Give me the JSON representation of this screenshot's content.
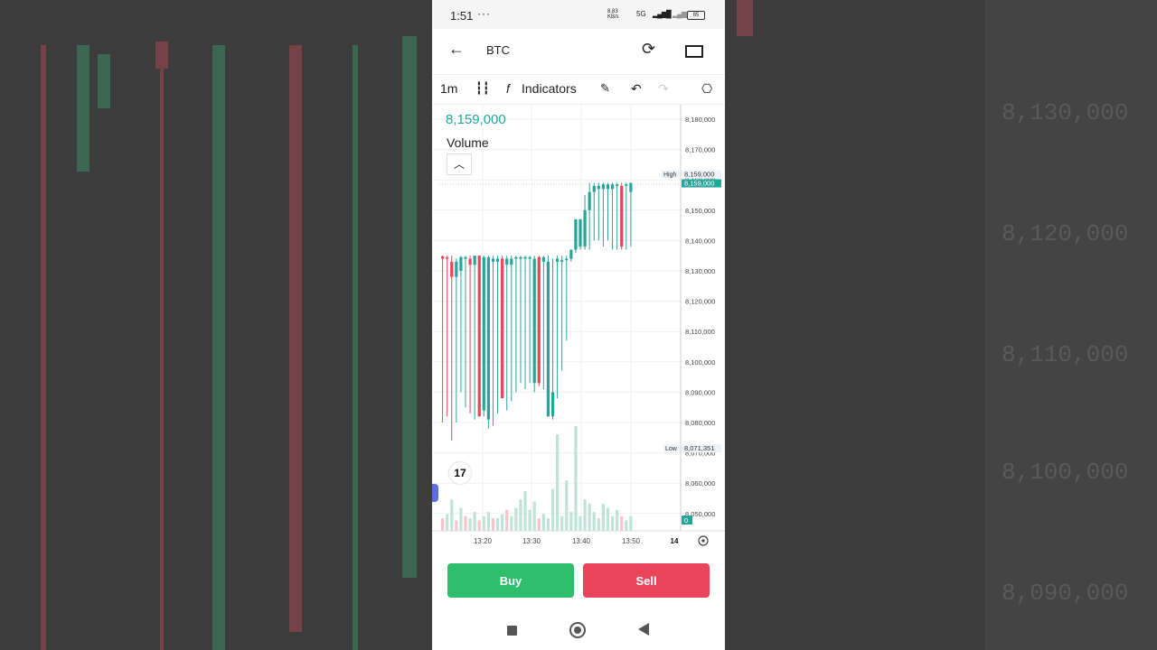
{
  "status_bar": {
    "time": "1:51",
    "notifications": "···",
    "speed_value": "8.83",
    "speed_unit": "KB/s",
    "network": "5G",
    "battery": "85"
  },
  "header": {
    "title": "BTC"
  },
  "toolbar": {
    "interval": "1m",
    "indicators_label": "Indicators"
  },
  "legend": {
    "price": "8,159,000",
    "volume_label": "Volume"
  },
  "actions": {
    "buy_label": "Buy",
    "sell_label": "Sell"
  },
  "colors": {
    "up": "#26a69a",
    "down": "#e9445a",
    "buy": "#2ebd6b",
    "sell": "#e9445a"
  },
  "chart_data": {
    "type": "candlestick",
    "price_axis": {
      "ticks": [
        8180000,
        8170000,
        8160000,
        8150000,
        8140000,
        8130000,
        8120000,
        8110000,
        8100000,
        8090000,
        8080000,
        8070000,
        8060000,
        8050000
      ],
      "tick_labels": [
        "8,180,000",
        "8,170,000",
        "8,160,000",
        "8,150,000",
        "8,140,000",
        "8,130,000",
        "8,120,000",
        "8,110,000",
        "8,100,000",
        "8,090,000",
        "8,080,000",
        "8,070,000",
        "8,060,000",
        "8,050,000"
      ]
    },
    "high_marker": {
      "label": "High",
      "value": "8,159,000"
    },
    "last_marker": {
      "value": "8,159,000"
    },
    "low_marker": {
      "label": "Low",
      "value": "8,071,351"
    },
    "volume_marker": "0",
    "time_axis": {
      "labels": [
        "13:20",
        "13:30",
        "13:40",
        "13:50",
        "14"
      ]
    },
    "candles": [
      {
        "o": 8134800,
        "h": 8135000,
        "l": 8080000,
        "c": 8134000,
        "d": "down"
      },
      {
        "o": 8134500,
        "h": 8135000,
        "l": 8082000,
        "c": 8134000,
        "d": "down"
      },
      {
        "o": 8133000,
        "h": 8135000,
        "l": 8074000,
        "c": 8128000,
        "d": "down"
      },
      {
        "o": 8128000,
        "h": 8134000,
        "l": 8080000,
        "c": 8133000,
        "d": "up"
      },
      {
        "o": 8130000,
        "h": 8135000,
        "l": 8090000,
        "c": 8134500,
        "d": "up"
      },
      {
        "o": 8134500,
        "h": 8135000,
        "l": 8085000,
        "c": 8134000,
        "d": "up"
      },
      {
        "o": 8134000,
        "h": 8135000,
        "l": 8083000,
        "c": 8132000,
        "d": "down"
      },
      {
        "o": 8132000,
        "h": 8135000,
        "l": 8081000,
        "c": 8135000,
        "d": "up"
      },
      {
        "o": 8135000,
        "h": 8135000,
        "l": 8082000,
        "c": 8082000,
        "d": "down"
      },
      {
        "o": 8084000,
        "h": 8135000,
        "l": 8082000,
        "c": 8134500,
        "d": "up"
      },
      {
        "o": 8134500,
        "h": 8135000,
        "l": 8078000,
        "c": 8081000,
        "d": "up"
      },
      {
        "o": 8134000,
        "h": 8135000,
        "l": 8079000,
        "c": 8133000,
        "d": "up"
      },
      {
        "o": 8133000,
        "h": 8135000,
        "l": 8083000,
        "c": 8134000,
        "d": "up"
      },
      {
        "o": 8134000,
        "h": 8135000,
        "l": 8088000,
        "c": 8088000,
        "d": "down"
      },
      {
        "o": 8134000,
        "h": 8135000,
        "l": 8084000,
        "c": 8132000,
        "d": "up"
      },
      {
        "o": 8132000,
        "h": 8135000,
        "l": 8087000,
        "c": 8134000,
        "d": "up"
      },
      {
        "o": 8134000,
        "h": 8135000,
        "l": 8090000,
        "c": 8134500,
        "d": "up"
      },
      {
        "o": 8134500,
        "h": 8135000,
        "l": 8093000,
        "c": 8134000,
        "d": "up"
      },
      {
        "o": 8134000,
        "h": 8135000,
        "l": 8091000,
        "c": 8134500,
        "d": "up"
      },
      {
        "o": 8134500,
        "h": 8135000,
        "l": 8093000,
        "c": 8134000,
        "d": "up"
      },
      {
        "o": 8134000,
        "h": 8135000,
        "l": 8090000,
        "c": 8093000,
        "d": "up"
      },
      {
        "o": 8134500,
        "h": 8135000,
        "l": 8092000,
        "c": 8093000,
        "d": "down"
      },
      {
        "o": 8133000,
        "h": 8135000,
        "l": 8091000,
        "c": 8134500,
        "d": "up"
      },
      {
        "o": 8133000,
        "h": 8135000,
        "l": 8090000,
        "c": 8082000,
        "d": "up"
      },
      {
        "o": 8082000,
        "h": 8134000,
        "l": 8081000,
        "c": 8090000,
        "d": "up"
      },
      {
        "o": 8134000,
        "h": 8135000,
        "l": 8088000,
        "c": 8133000,
        "d": "up"
      },
      {
        "o": 8133000,
        "h": 8135000,
        "l": 8097000,
        "c": 8133500,
        "d": "up"
      },
      {
        "o": 8133500,
        "h": 8135000,
        "l": 8107000,
        "c": 8134000,
        "d": "up"
      },
      {
        "o": 8134000,
        "h": 8136000,
        "l": 8133000,
        "c": 8137000,
        "d": "up"
      },
      {
        "o": 8137000,
        "h": 8147000,
        "l": 8136000,
        "c": 8147000,
        "d": "up"
      },
      {
        "o": 8147000,
        "h": 8147000,
        "l": 8137000,
        "c": 8138000,
        "d": "up"
      },
      {
        "o": 8138000,
        "h": 8155000,
        "l": 8137000,
        "c": 8150000,
        "d": "up"
      },
      {
        "o": 8150000,
        "h": 8159000,
        "l": 8137000,
        "c": 8156000,
        "d": "up"
      },
      {
        "o": 8156000,
        "h": 8159000,
        "l": 8140000,
        "c": 8158000,
        "d": "up"
      },
      {
        "o": 8158000,
        "h": 8159000,
        "l": 8140000,
        "c": 8157000,
        "d": "up"
      },
      {
        "o": 8157000,
        "h": 8159000,
        "l": 8138000,
        "c": 8158500,
        "d": "up"
      },
      {
        "o": 8158500,
        "h": 8159000,
        "l": 8140000,
        "c": 8157000,
        "d": "up"
      },
      {
        "o": 8157000,
        "h": 8159000,
        "l": 8137000,
        "c": 8158500,
        "d": "up"
      },
      {
        "o": 8158500,
        "h": 8159000,
        "l": 8137000,
        "c": 8158000,
        "d": "up"
      },
      {
        "o": 8158000,
        "h": 8159000,
        "l": 8137000,
        "c": 8138000,
        "d": "down"
      },
      {
        "o": 8158000,
        "h": 8159000,
        "l": 8137000,
        "c": 8158500,
        "d": "up"
      },
      {
        "o": 8156000,
        "h": 8159000,
        "l": 8138000,
        "c": 8159000,
        "d": "up"
      }
    ],
    "volumes": [
      0.12,
      0.16,
      0.3,
      0.1,
      0.22,
      0.14,
      0.12,
      0.18,
      0.1,
      0.14,
      0.18,
      0.12,
      0.12,
      0.16,
      0.2,
      0.14,
      0.22,
      0.3,
      0.38,
      0.2,
      0.28,
      0.12,
      0.16,
      0.12,
      0.4,
      0.92,
      0.14,
      0.48,
      0.18,
      1.0,
      0.14,
      0.3,
      0.26,
      0.18,
      0.12,
      0.26,
      0.22,
      0.14,
      0.2,
      0.14,
      0.1,
      0.14
    ],
    "vol_colors": [
      "down",
      "up",
      "up",
      "down",
      "up",
      "down",
      "up",
      "up",
      "down",
      "up",
      "up",
      "down",
      "up",
      "up",
      "down",
      "up",
      "up",
      "up",
      "up",
      "up",
      "up",
      "down",
      "up",
      "up",
      "up",
      "up",
      "up",
      "up",
      "up",
      "up",
      "up",
      "up",
      "up",
      "up",
      "up",
      "up",
      "up",
      "up",
      "up",
      "down",
      "up",
      "up"
    ]
  }
}
